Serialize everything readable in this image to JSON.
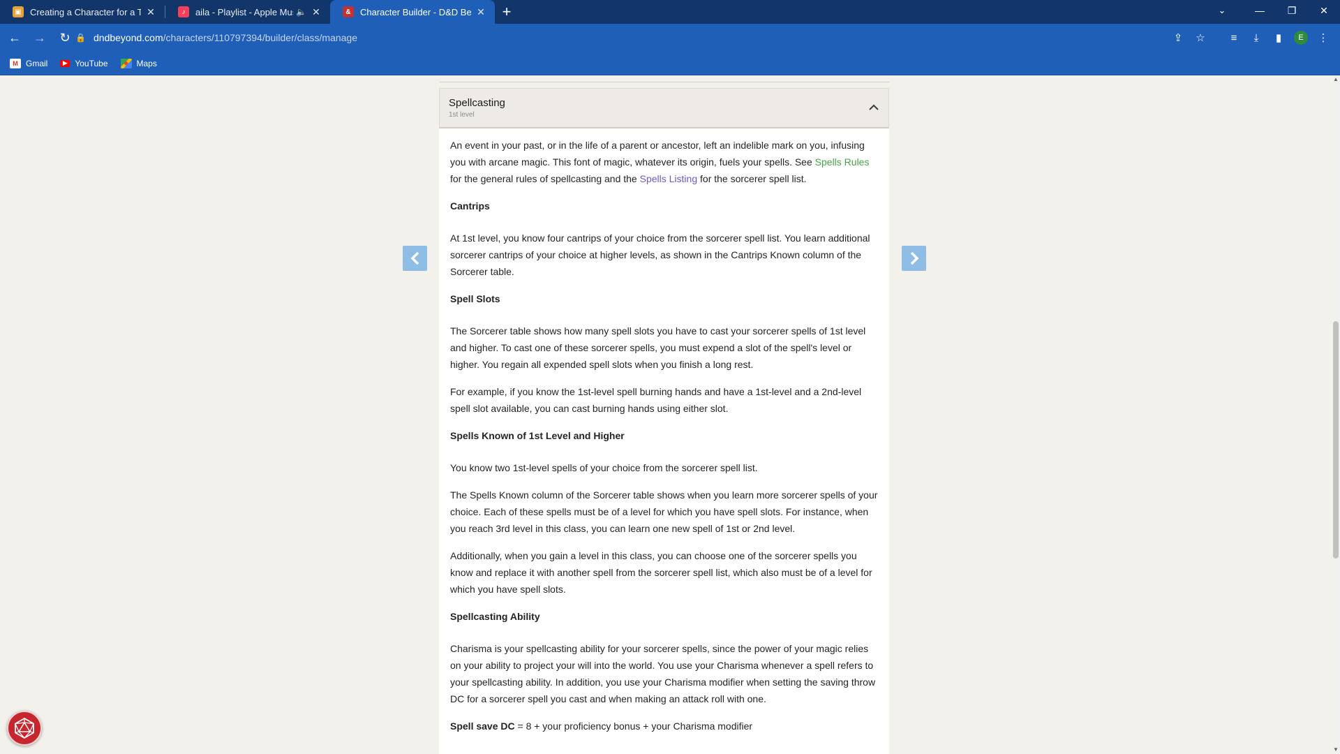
{
  "browser": {
    "tabs": [
      {
        "title": "Creating a Character for a Table",
        "active": false
      },
      {
        "title": "aila - Playlist - Apple Music",
        "active": false,
        "audio": true
      },
      {
        "title": "Character Builder - D&D Beyond",
        "active": true
      }
    ],
    "url_host": "dndbeyond.com",
    "url_path": "/characters/110797394/builder/class/manage",
    "profile_initial": "E",
    "bookmarks": [
      {
        "label": "Gmail"
      },
      {
        "label": "YouTube"
      },
      {
        "label": "Maps"
      }
    ]
  },
  "section": {
    "title": "Spellcasting",
    "subtitle": "1st level"
  },
  "content": {
    "intro_before_link1": "An event in your past, or in the life of a parent or ancestor, left an indelible mark on you, infusing you with arcane magic. This font of magic, whatever its origin, fuels your spells. See ",
    "link1": "Spells Rules",
    "intro_between": " for the general rules of spellcasting and the ",
    "link2": "Spells Listing",
    "intro_after": " for the sorcerer spell list.",
    "cantrips_heading": "Cantrips",
    "cantrips_text": "At 1st level, you know four cantrips of your choice from the sorcerer spell list. You learn additional sorcerer cantrips of your choice at higher levels, as shown in the Cantrips Known column of the Sorcerer table.",
    "slots_heading": "Spell Slots",
    "slots_text_1": "The Sorcerer table shows how many spell slots you have to cast your sorcerer spells of 1st level and higher. To cast one of these sorcerer spells, you must expend a slot of the spell's level or higher. You regain all expended spell slots when you finish a long rest.",
    "slots_text_2": "For example, if you know the 1st-level spell burning hands and have a 1st-level and a 2nd-level spell slot available, you can cast burning hands using either slot.",
    "known_heading": "Spells Known of 1st Level and Higher",
    "known_text_1": "You know two 1st-level spells of your choice from the sorcerer spell list.",
    "known_text_2": "The Spells Known column of the Sorcerer table shows when you learn more sorcerer spells of your choice. Each of these spells must be of a level for which you have spell slots. For instance, when you reach 3rd level in this class, you can learn one new spell of 1st or 2nd level.",
    "known_text_3": "Additionally, when you gain a level in this class, you can choose one of the sorcerer spells you know and replace it with another spell from the sorcerer spell list, which also must be of a level for which you have spell slots.",
    "ability_heading": "Spellcasting Ability",
    "ability_text": "Charisma is your spellcasting ability for your sorcerer spells, since the power of your magic relies on your ability to project your will into the world. You use your Charisma whenever a spell refers to your spellcasting ability. In addition, you use your Charisma modifier when setting the saving throw DC for a sorcerer spell you cast and when making an attack roll with one.",
    "save_dc_label": "Spell save DC",
    "save_dc_text": " = 8 + your proficiency bonus + your Charisma modifier"
  },
  "icons": {
    "prev_arrow": "chevron-left-icon",
    "next_arrow": "chevron-right-icon",
    "collapse": "chevron-up-icon",
    "dice": "d20-icon"
  },
  "colors": {
    "tab_bar": "#12366a",
    "toolbar": "#1f5fb8",
    "link_green": "#47a34a",
    "link_blue": "#6b58c9",
    "arrow_bg": "#8fbde6",
    "dice_red": "#c8262e"
  }
}
